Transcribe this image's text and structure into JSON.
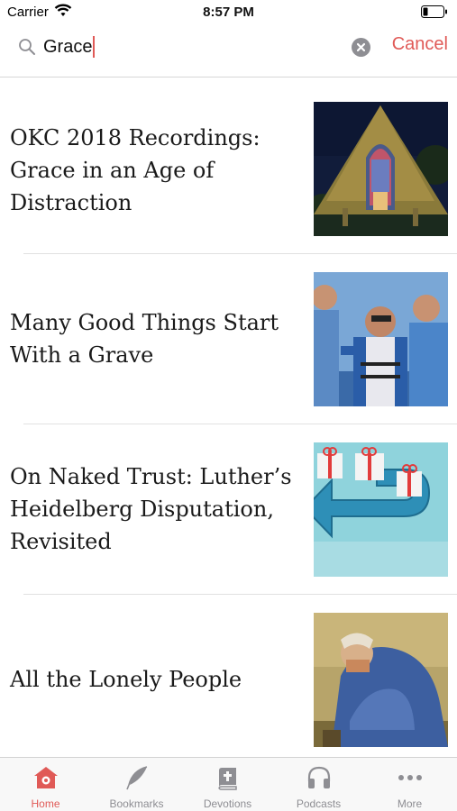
{
  "status_bar": {
    "carrier": "Carrier",
    "time": "8:57 PM"
  },
  "search": {
    "value": "Grace",
    "cancel_label": "Cancel"
  },
  "results": [
    {
      "title": "OKC 2018 Recordings: Grace in an Age of Distraction",
      "thumbnail": "church-at-night-photo"
    },
    {
      "title": "Many Good Things Start With a Grave",
      "thumbnail": "three-men-photo"
    },
    {
      "title": "On Naked Trust: Luther’s Heidelberg Disputation, Revisited",
      "thumbnail": "gifts-and-arrow-illustration"
    },
    {
      "title": "All the Lonely People",
      "thumbnail": "sorrowing-old-man-painting"
    }
  ],
  "tab_bar": {
    "tabs": [
      {
        "label": "Home",
        "icon": "home-icon",
        "active": true
      },
      {
        "label": "Bookmarks",
        "icon": "feather-icon",
        "active": false
      },
      {
        "label": "Devotions",
        "icon": "book-icon",
        "active": false
      },
      {
        "label": "Podcasts",
        "icon": "headphones-icon",
        "active": false
      },
      {
        "label": "More",
        "icon": "more-icon",
        "active": false
      }
    ]
  },
  "colors": {
    "accent": "#e05a57",
    "inactive": "#8e8e93"
  }
}
